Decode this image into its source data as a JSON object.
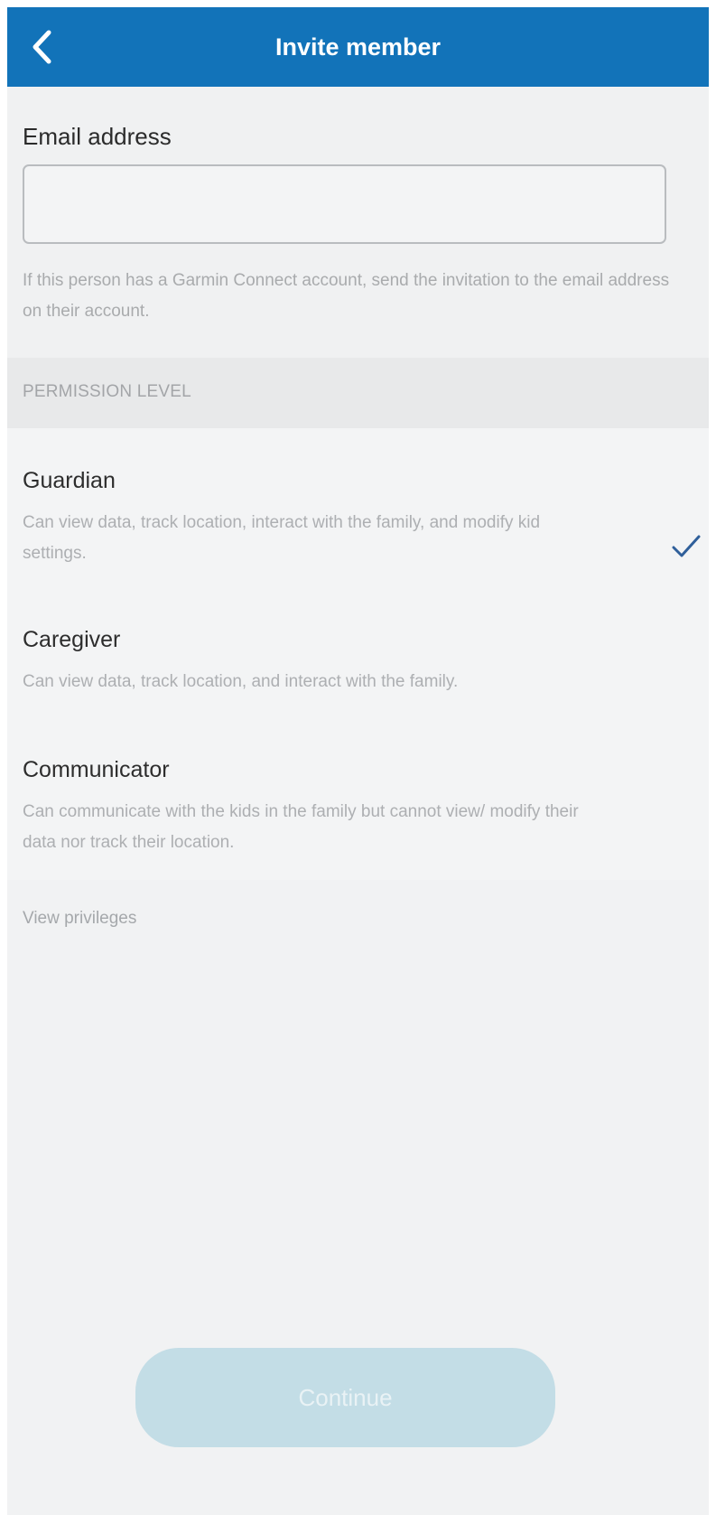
{
  "header": {
    "title": "Invite member",
    "back_icon": "chevron-left-icon",
    "background_color": "#1273b9"
  },
  "email": {
    "label": "Email address",
    "value": "",
    "placeholder": "",
    "help_text": "If this person has a Garmin Connect account, send the invitation to the email address on their account."
  },
  "permission": {
    "section_title": "PERMISSION LEVEL",
    "selected": "Guardian",
    "options": [
      {
        "title": "Guardian",
        "description": "Can view data, track location, interact with the family, and modify kid settings.",
        "selected": true
      },
      {
        "title": "Caregiver",
        "description": "Can view data, track location, and interact with the family.",
        "selected": false
      },
      {
        "title": "Communicator",
        "description": "Can communicate with the kids in the family but cannot view/ modify their data nor track their location.",
        "selected": false
      }
    ],
    "check_icon": "checkmark-icon",
    "check_color": "#2f5f9a"
  },
  "links": {
    "view_privileges": "View privileges"
  },
  "footer": {
    "continue_label": "Continue",
    "continue_enabled": false
  }
}
